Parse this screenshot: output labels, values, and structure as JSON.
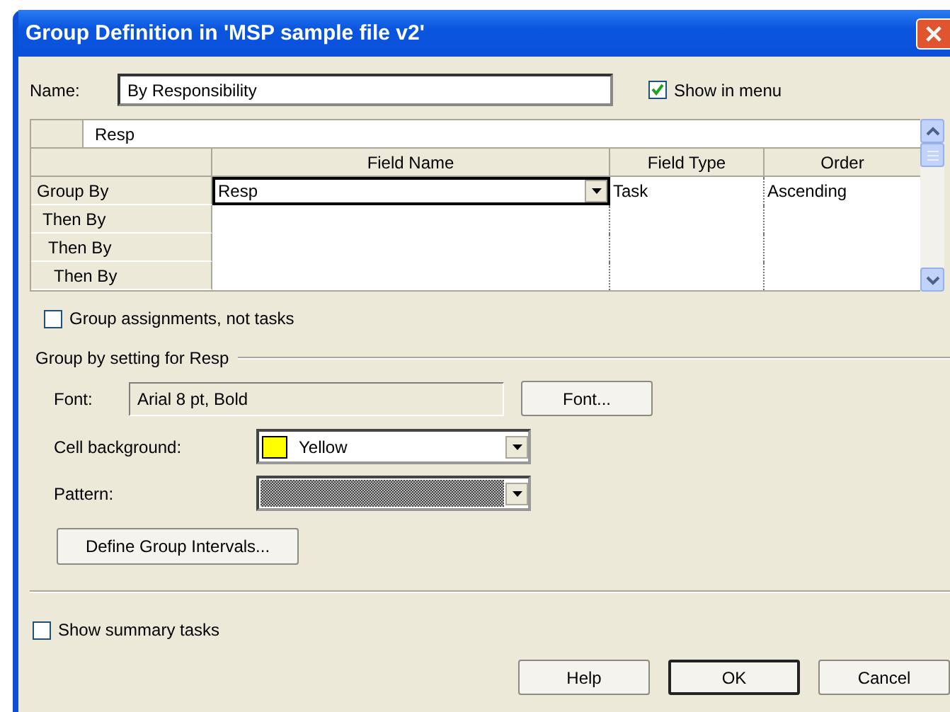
{
  "window": {
    "title": "Group Definition in 'MSP sample file v2'"
  },
  "name": {
    "label": "Name:",
    "value": "By Responsibility"
  },
  "show_in_menu": {
    "label": "Show in menu",
    "checked": true
  },
  "grid": {
    "edit_value": "Resp",
    "columns": [
      "Field Name",
      "Field Type",
      "Order"
    ],
    "rows": [
      {
        "label": "Group By",
        "field_name": "Resp",
        "field_type": "Task",
        "order": "Ascending",
        "selected": true
      },
      {
        "label": "Then By",
        "selected": false
      },
      {
        "label": "Then By",
        "selected": false
      },
      {
        "label": "Then By",
        "selected": false
      }
    ]
  },
  "group_assignments": {
    "label": "Group assignments, not tasks",
    "checked": false
  },
  "settings": {
    "title": "Group by setting for Resp",
    "font": {
      "label": "Font:",
      "value": "Arial 8 pt, Bold"
    },
    "font_button": "Font...",
    "cell_background": {
      "label": "Cell background:",
      "value": "Yellow",
      "color": "#ffff00"
    },
    "pattern": {
      "label": "Pattern:"
    },
    "intervals_button": "Define Group Intervals..."
  },
  "show_summary": {
    "label": "Show summary tasks",
    "checked": false
  },
  "buttons": [
    {
      "label": "Help",
      "default": false
    },
    {
      "label": "OK",
      "default": true
    },
    {
      "label": "Cancel",
      "default": false
    }
  ]
}
